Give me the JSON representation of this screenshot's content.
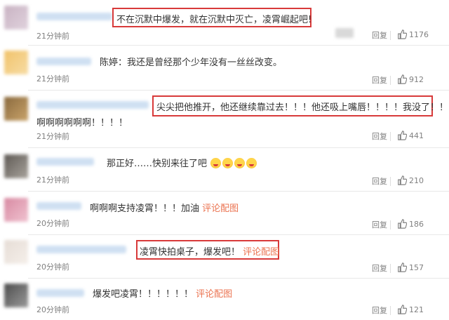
{
  "reply_label": "回复",
  "comments": [
    {
      "text": "不在沉默中爆发，就在沉默中灭亡，凌霄崛起吧!",
      "time": "21分钟前",
      "likes": "1176"
    },
    {
      "prefix": "陈婷",
      "text": "：我还是曾经那个少年没有一丝丝改变。",
      "time": "21分钟前",
      "likes": "912"
    },
    {
      "text": "尖尖把他推开，他还继续靠过去！！！他还吸上嘴唇！！！！我没了！！！",
      "text2": "啊啊啊啊啊啊！！！！",
      "time": "21分钟前",
      "likes": "441"
    },
    {
      "text": "那正好……快别来往了吧",
      "time": "21分钟前",
      "likes": "210"
    },
    {
      "text": "啊啊啊支持凌霄！！！加油",
      "link": "评论配图",
      "time": "20分钟前",
      "likes": "186"
    },
    {
      "text": "凌霄快拍桌子，爆发吧！",
      "link": "评论配图",
      "time": "20分钟前",
      "likes": "157"
    },
    {
      "text": "爆发吧凌霄！！！！！！",
      "link": "评论配图",
      "time": "20分钟前",
      "likes": "121"
    }
  ],
  "colors": {
    "highlight_border": "#d83a3a",
    "link": "#eb7350",
    "meta": "#808080"
  }
}
